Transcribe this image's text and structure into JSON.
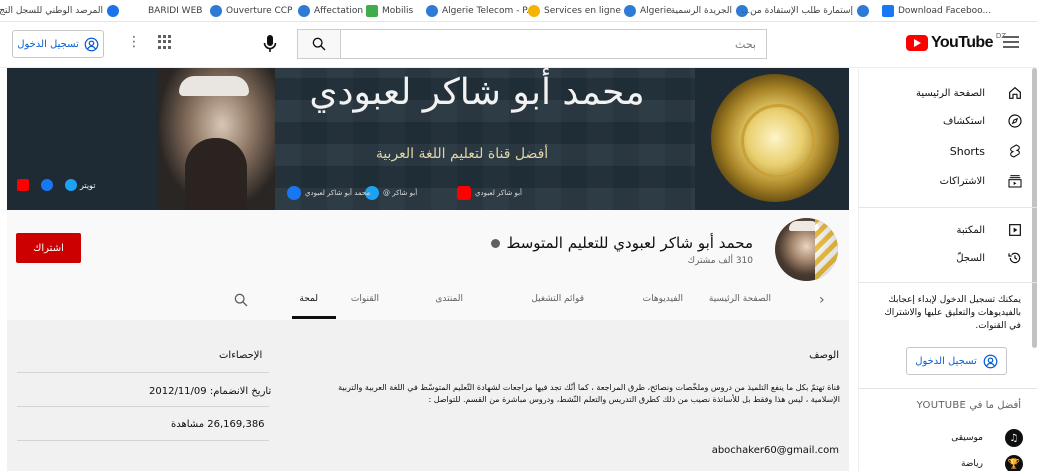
{
  "bookmarks": [
    {
      "label": "المرصد الوطني للسجل التج...",
      "color": "#1a73e8"
    },
    {
      "label": "BARIDI WEB",
      "color": ""
    },
    {
      "label": "Ouverture CCP",
      "color": "#2e7bd6"
    },
    {
      "label": "Affectation",
      "color": "#2e7bd6"
    },
    {
      "label": "Mobilis",
      "color": "#3fae49"
    },
    {
      "label": "Algerie Telecom - P...",
      "color": "#2e7bd6"
    },
    {
      "label": "Services en ligne -...",
      "color": "#f4b400"
    },
    {
      "label": "Algerie",
      "color": "#2e7bd6"
    },
    {
      "label": "الجريدة الرسمية",
      "color": "#2e7bd6"
    },
    {
      "label": "إستمارة طلب الإستفادة من...",
      "color": "#2e7bd6"
    },
    {
      "label": "Download Faceboo...",
      "color": "#1877f2"
    }
  ],
  "masthead": {
    "signin_label": "تسجيل الدخول",
    "search_placeholder": "بحث",
    "logo_text": "YouTube",
    "logo_region": "DZ"
  },
  "guide": {
    "items": [
      {
        "label": "الصفحة الرئيسية",
        "icon": "home-icon"
      },
      {
        "label": "استكشاف",
        "icon": "explore-icon"
      },
      {
        "label": "Shorts",
        "icon": "shorts-icon"
      },
      {
        "label": "الاشتراكات",
        "icon": "subscriptions-icon"
      },
      {
        "label": "المكتبة",
        "icon": "library-icon"
      },
      {
        "label": "السجلّ",
        "icon": "history-icon"
      }
    ],
    "signin_prompt": "يمكنك تسجيل الدخول لإبداء إعجابك بالفيديوهات والتعليق عليها والاشتراك في القنوات.",
    "signin_label": "تسجيل الدخول",
    "best_title": "أفضل ما في YOUTUBE",
    "categories": [
      {
        "label": "موسيقى",
        "icon": "music-icon"
      },
      {
        "label": "رياضة",
        "icon": "sports-icon"
      }
    ]
  },
  "banner": {
    "calligraphy": "محمد أبو شاكر لعبودي",
    "subtitle": "أفضل قناة لتعليم اللغة العربية",
    "social": [
      {
        "label": "أبو شاكر لعبودي",
        "color": "#ff0000"
      },
      {
        "label": "@ أبو شاكر",
        "color": "#1da1f2"
      },
      {
        "label": "محمد أبو شاكر لعبودي",
        "color": "#1877f2"
      }
    ],
    "links": {
      "twitter_label": "تويتر"
    }
  },
  "channel": {
    "name": "محمد أبو شاكر لعبودي للتعليم المتوسط",
    "subscribers": "310 ألف مشترك",
    "subscribe_label": "اشتراك"
  },
  "tabs": {
    "home": "الصفحة الرئيسية",
    "videos": "الفيديوهات",
    "playlists": "قوائم التشغيل",
    "community": "المنتدى",
    "channels": "القنوات",
    "about": "لمحة"
  },
  "about": {
    "description_title": "الوصف",
    "description": "قناة تهتمّ بكل ما ينفع التلميذ من دروس وملخّصات ونصائح، طرق المراجعة ، كما أنّك تجد فيها مراجعات لشهادة التّعليم المتوسّط في اللغة العربية والتربية الإسلامية ، ليس هذا وفقط بل للأساتذة نصيب من ذلك كطرق التدريس والتعلم النّشط، ودروس مباشرة من القسم. للتواصل :",
    "email": "abochaker60@gmail.com",
    "stats_title": "الإحصاءات",
    "joined_label": "تاريخ الانضمام:",
    "joined_date": "2012/11/09",
    "views_count": "26,169,386",
    "views_label": "مشاهدة"
  },
  "colors": {
    "brand_red": "#ff0000",
    "subscribe_red": "#cc0000",
    "link_blue": "#065fd4"
  }
}
